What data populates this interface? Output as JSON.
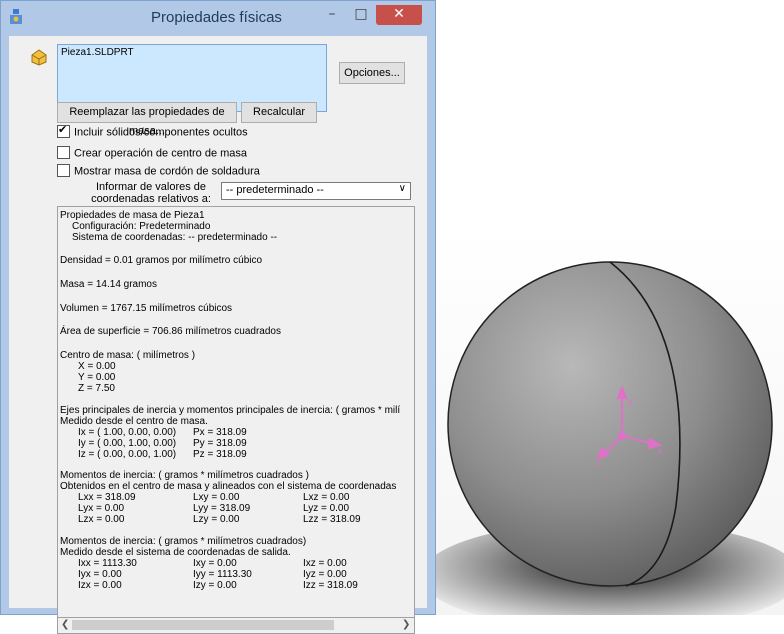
{
  "window": {
    "title": "Propiedades físicas",
    "minimize_glyph": "–",
    "maximize_glyph": "□",
    "close_glyph": "✕"
  },
  "selection": {
    "item": "Pieza1.SLDPRT"
  },
  "buttons": {
    "options": "Opciones...",
    "override_mass": "Reemplazar las propiedades de masa...",
    "recalculate": "Recalcular"
  },
  "checkboxes": [
    {
      "label": "Incluir sólidos/componentes ocultos",
      "checked": true
    },
    {
      "label": "Crear operación de centro de masa",
      "checked": false
    },
    {
      "label": "Mostrar masa de cordón de soldadura",
      "checked": false
    }
  ],
  "coordinates": {
    "label_line1": "Informar de valores de",
    "label_line2": "coordenadas relativos a:",
    "selected": "-- predeterminado --"
  },
  "results": {
    "header": "Propiedades de masa de Pieza1",
    "config": "Configuración:  Predeterminado",
    "coord_system": "Sistema de coordenadas:  -- predeterminado --",
    "density": "Densidad = 0.01 gramos por milímetro cúbico",
    "mass": "Masa = 14.14 gramos",
    "volume": "Volumen = 1767.15 milímetros cúbicos",
    "surface_area": "Área de superficie = 706.86  milímetros cuadrados",
    "com_title": "Centro de masa: ( milímetros )",
    "com_x": "X = 0.00",
    "com_y": "Y = 0.00",
    "com_z": "Z = 7.50",
    "principal_title": "Ejes principales de inercia y momentos principales de inercia: ( gramos *  milí",
    "principal_sub": "Medido desde el centro de masa.",
    "ix": "Ix = ( 1.00,  0.00,  0.00)",
    "iy": "Iy = ( 0.00,  1.00,  0.00)",
    "iz": "Iz = ( 0.00,  0.00,  1.00)",
    "px": "Px = 318.09",
    "py": "Py = 318.09",
    "pz": "Pz = 318.09",
    "moi_title": "Momentos de inercia: ( gramos *  milímetros cuadrados )",
    "moi_sub": "Obtenidos en el centro de masa y alineados con el sistema de coordenadas",
    "lxx": "Lxx = 318.09",
    "lxy": "Lxy = 0.00",
    "lxz": "Lxz = 0.00",
    "lyx": "Lyx = 0.00",
    "lyy": "Lyy = 318.09",
    "lyz": "Lyz = 0.00",
    "lzx": "Lzx = 0.00",
    "lzy": "Lzy = 0.00",
    "lzz": "Lzz = 318.09",
    "moi2_title": "Momentos de inercia: ( gramos *  milímetros cuadrados)",
    "moi2_sub": "Medido desde el sistema de coordenadas de salida.",
    "ixx": "Ixx = 1113.30",
    "ixy": "Ixy = 0.00",
    "ixz": "Ixz = 0.00",
    "iyx": "Iyx = 0.00",
    "iyy": "Iyy = 1113.30",
    "iyz": "Iyz = 0.00",
    "izx": "Izx = 0.00",
    "izy": "Izy = 0.00",
    "izz": "Izz = 318.09"
  },
  "viewport": {
    "axis_x": "x",
    "axis_y": "y",
    "axis_z": "z",
    "triad_color": "#e070c8"
  },
  "colors": {
    "frame": "#b1c9e6",
    "close_button": "#c7504a",
    "selection_box": "#cce8ff"
  }
}
